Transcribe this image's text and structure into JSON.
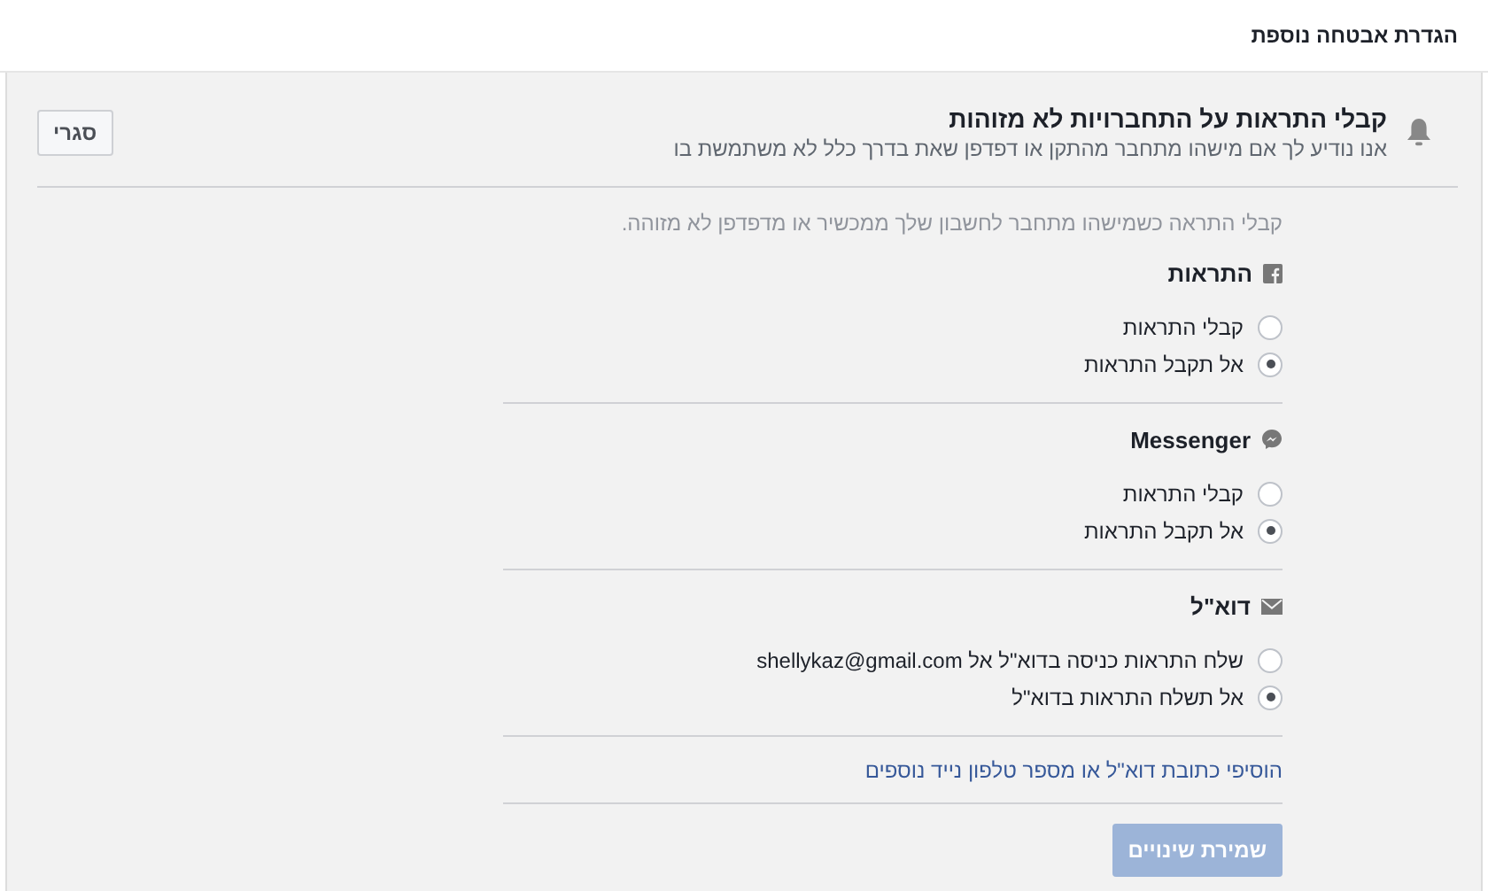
{
  "page_title": "הגדרת אבטחה נוספת",
  "setting": {
    "title": "קבלי התראות על התחברויות לא מזוהות",
    "subtitle": "אנו נודיע לך אם מישהו מתחבר מהתקן או דפדפן שאת בדרך כלל לא משתמשת בו",
    "close_button": "סגרי"
  },
  "description": "קבלי התראה כשמישהו מתחבר לחשבון שלך ממכשיר או מדפדפן לא מזוהה.",
  "sections": [
    {
      "kind": "facebook",
      "title": "התראות",
      "options": [
        {
          "label": "קבלי התראות",
          "selected": false
        },
        {
          "label": "אל תקבל התראות",
          "selected": true
        }
      ]
    },
    {
      "kind": "messenger",
      "title": "Messenger",
      "options": [
        {
          "label": "קבלי התראות",
          "selected": false
        },
        {
          "label": "אל תקבל התראות",
          "selected": true
        }
      ]
    },
    {
      "kind": "email",
      "title": "דוא\"ל",
      "options": [
        {
          "label": "שלח התראות כניסה בדוא\"ל אל shellykaz@gmail.com",
          "selected": false
        },
        {
          "label": "אל תשלח התראות בדוא\"ל",
          "selected": true
        }
      ]
    }
  ],
  "add_contact_link": "הוסיפי כתובת דוא\"ל או מספר טלפון נייד נוספים",
  "save_button": {
    "label": "שמירת שינויים",
    "disabled": true
  }
}
